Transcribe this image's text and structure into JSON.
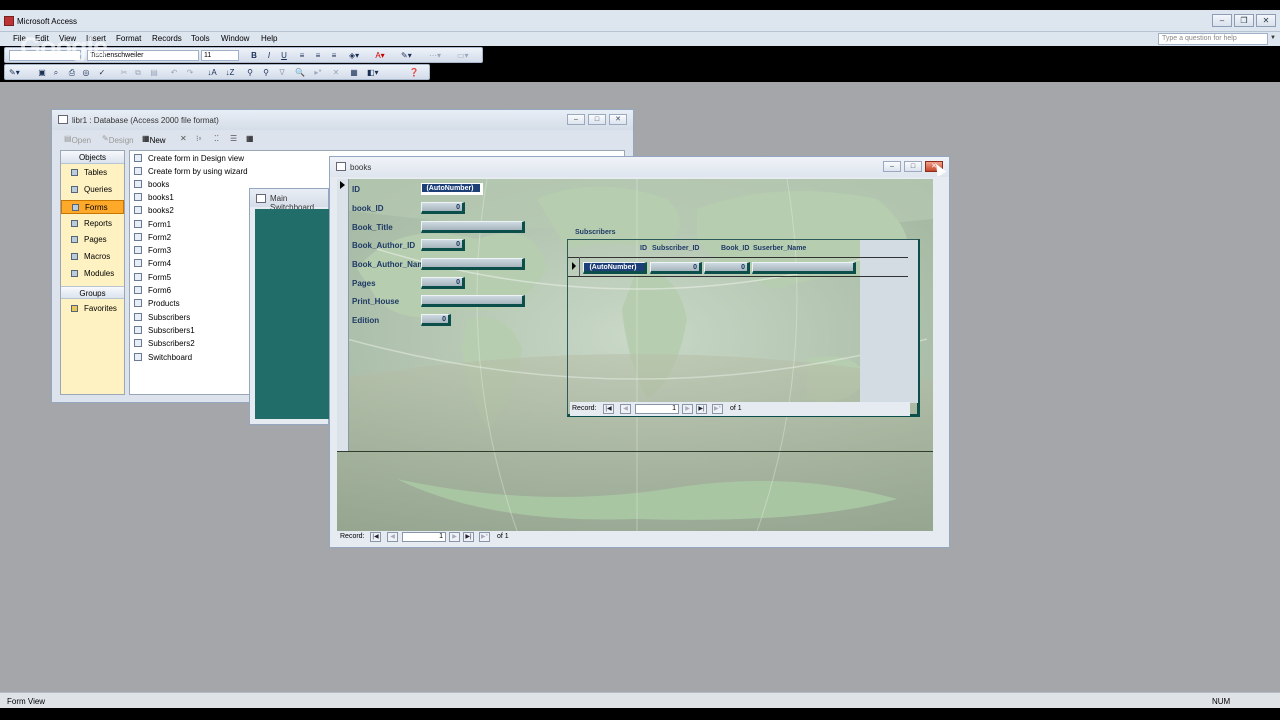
{
  "app": {
    "title": "Microsoft Access",
    "help_placeholder": "Type a question for help"
  },
  "menu": [
    "File",
    "Edit",
    "View",
    "Insert",
    "Format",
    "Records",
    "Tools",
    "Window",
    "Help"
  ],
  "format_toolbar": {
    "font": "Tischenschweiler",
    "size": "11"
  },
  "overlay_logo": "Google",
  "db_window": {
    "title": "libr1 : Database (Access 2000 file format)",
    "toolbar": {
      "open": "Open",
      "design": "Design",
      "new": "New"
    },
    "objects_header": "Objects",
    "objects": [
      "Tables",
      "Queries",
      "Forms",
      "Reports",
      "Pages",
      "Macros",
      "Modules"
    ],
    "selected_object": "Forms",
    "groups_header": "Groups",
    "groups": [
      "Favorites"
    ],
    "list": [
      "Create form in Design view",
      "Create form by using wizard",
      "books",
      "books1",
      "books2",
      "Form1",
      "Form2",
      "Form3",
      "Form4",
      "Form5",
      "Form6",
      "Products",
      "Subscribers",
      "Subscribers1",
      "Subscribers2",
      "Switchboard"
    ]
  },
  "switchboard_window": {
    "title": "Main Switchboard"
  },
  "books_form": {
    "title": "books",
    "fields": [
      {
        "label": "ID",
        "value": "(AutoNumber)"
      },
      {
        "label": "book_ID",
        "value": "0"
      },
      {
        "label": "Book_Title",
        "value": ""
      },
      {
        "label": "Book_Author_ID",
        "value": "0"
      },
      {
        "label": "Book_Author_Name",
        "value": ""
      },
      {
        "label": "Pages",
        "value": "0"
      },
      {
        "label": "Print_House",
        "value": ""
      },
      {
        "label": "Edition",
        "value": "0"
      }
    ],
    "subform": {
      "label": "Subscribers",
      "columns": [
        "ID",
        "Subscriber_ID",
        "Book_ID",
        "Suserber_Name"
      ],
      "row": [
        "(AutoNumber)",
        "0",
        "0",
        ""
      ],
      "nav": {
        "label": "Record:",
        "current": "1",
        "of": "of 1"
      }
    },
    "nav": {
      "label": "Record:",
      "current": "1",
      "of": "of 1"
    }
  },
  "status": {
    "left": "Form View",
    "right": "NUM"
  },
  "colors": {
    "workspace": "#a5a6a9",
    "teal": "#216d6a",
    "form_bg": "#a9c2a9",
    "selected_object": "#ffa92b"
  }
}
